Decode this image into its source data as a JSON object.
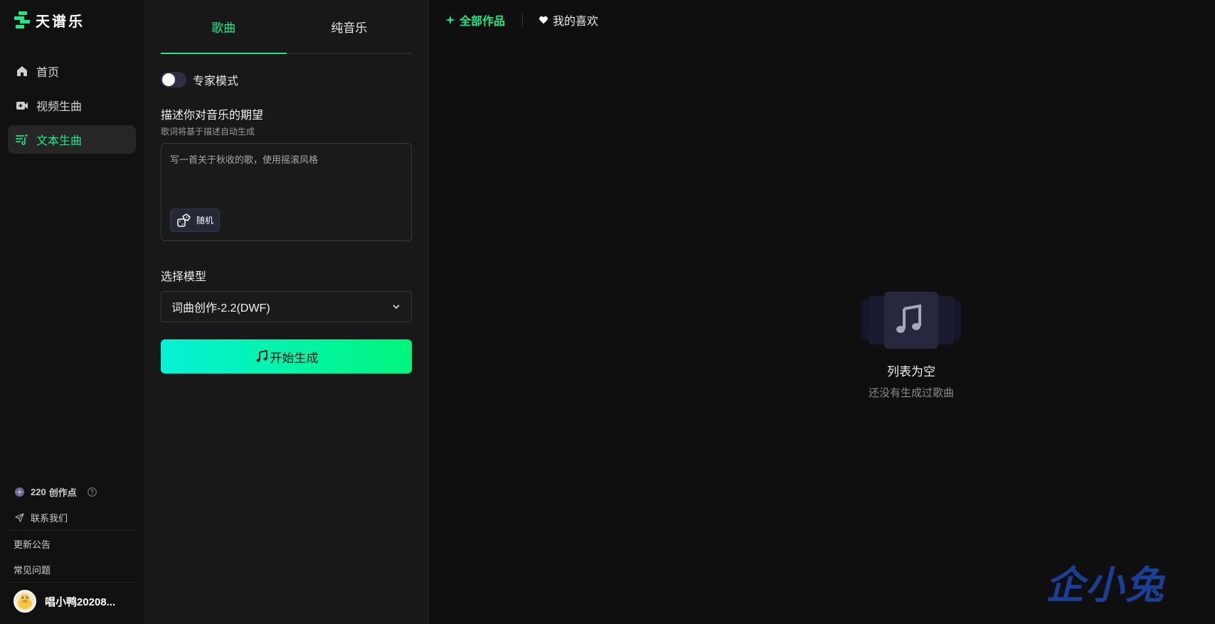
{
  "app": {
    "name": "天谱乐"
  },
  "sidebar": {
    "items": [
      {
        "label": "首页",
        "icon": "home-icon",
        "active": false
      },
      {
        "label": "视频生曲",
        "icon": "video-icon",
        "active": false
      },
      {
        "label": "文本生曲",
        "icon": "text-music-icon",
        "active": true
      }
    ],
    "credits": {
      "amount": "220",
      "label": "创作点"
    },
    "contact_label": "联系我们",
    "updates_label": "更新公告",
    "faq_label": "常见问题",
    "user": {
      "name": "唱小鸭20208..."
    }
  },
  "panel": {
    "tabs": [
      {
        "label": "歌曲",
        "active": true
      },
      {
        "label": "纯音乐",
        "active": false
      }
    ],
    "expert_mode": {
      "label": "专家模式",
      "enabled": false
    },
    "describe": {
      "title": "描述你对音乐的期望",
      "subtitle": "歌词将基于描述自动生成",
      "placeholder": "写一首关于秋收的歌，使用摇滚风格",
      "random_label": "随机"
    },
    "model": {
      "label": "选择模型",
      "selected": "词曲创作-2.2(DWF)"
    },
    "generate_label": "开始生成"
  },
  "main": {
    "filters": [
      {
        "label": "全部作品",
        "active": true,
        "icon": "sparkle-icon"
      },
      {
        "label": "我的喜欢",
        "active": false,
        "icon": "heart-icon"
      }
    ],
    "empty": {
      "title": "列表为空",
      "subtitle": "还没有生成过歌曲"
    },
    "watermark": "企小兔"
  },
  "colors": {
    "accent": "#1ee98a",
    "gradient_start": "#07f2d7",
    "gradient_end": "#00f57c",
    "watermark": "#1b3f96"
  }
}
